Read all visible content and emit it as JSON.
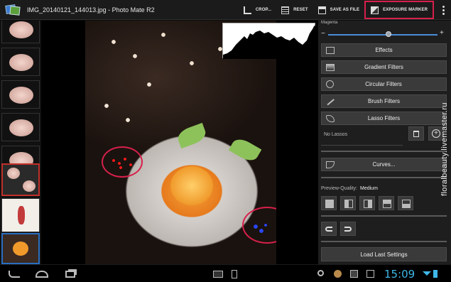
{
  "app": {
    "window_title": "IMG_20140121_144013.jpg - Photo Mate R2"
  },
  "toolbar": {
    "crop_label": "CROP...",
    "reset_label": "RESET",
    "save_as_file_label": "SAVE AS FILE",
    "exposure_marker_label": "EXPOSURE MARKER"
  },
  "panel": {
    "magenta_label": "Magenta",
    "minus": "−",
    "plus": "+",
    "magenta_value_fraction": 0.55,
    "buttons": [
      {
        "label": "Effects",
        "icon": "fx-icon"
      },
      {
        "label": "Gradient Filters",
        "icon": "gradient-filter-icon"
      },
      {
        "label": "Circular Filters",
        "icon": "circle-filter-icon"
      },
      {
        "label": "Brush Filters",
        "icon": "brush-icon"
      },
      {
        "label": "Lasso Filters",
        "icon": "lasso-icon"
      }
    ],
    "no_lassos_label": "No Lassos",
    "curves_label": "Curves...",
    "preview_quality_label": "Preview-Quality:",
    "preview_quality_value": "Medium",
    "load_last_settings_label": "Load Last Settings"
  },
  "system": {
    "clock": "15:09"
  },
  "watermark": "floralbeauty.livemaster.ru",
  "colors": {
    "highlight": "#d6204b",
    "slider": "#4a8dd6",
    "clock": "#3fb8e8"
  }
}
